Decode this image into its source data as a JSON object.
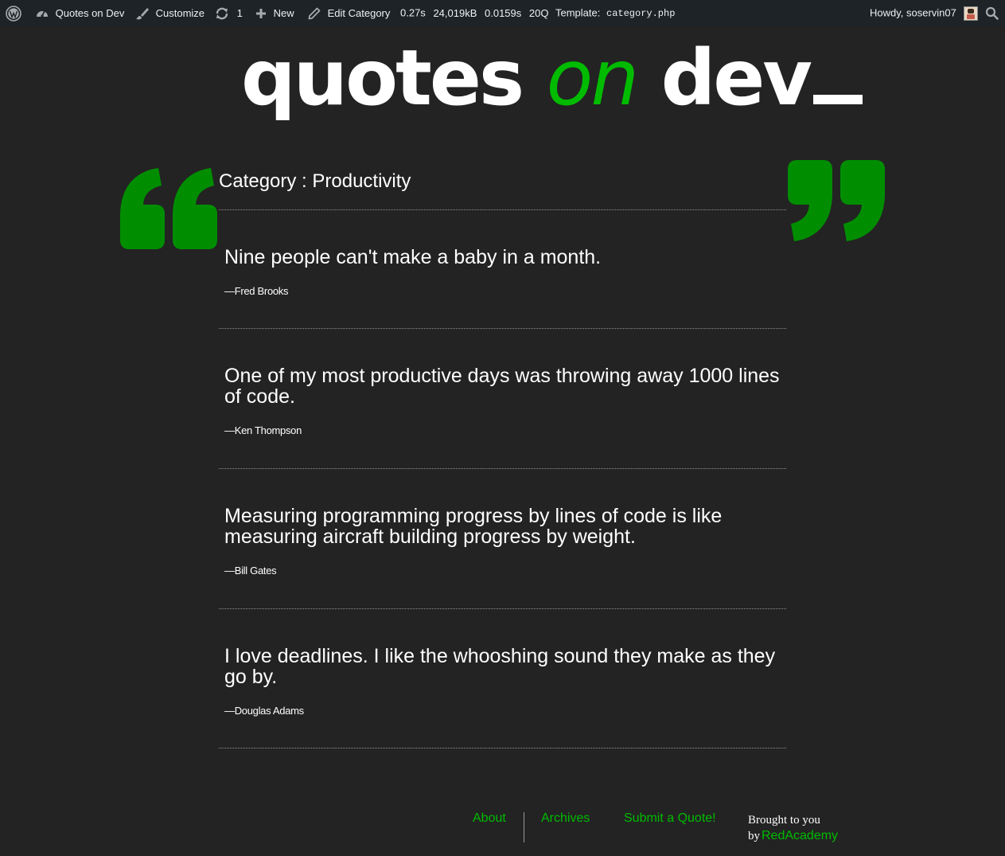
{
  "adminbar": {
    "site_name": "Quotes on Dev",
    "customize": "Customize",
    "updates_count": "1",
    "new": "New",
    "edit": "Edit Category",
    "stats": {
      "time": "0.27s",
      "memory": "24,019kB",
      "query_time": "0.0159s",
      "queries": "20Q"
    },
    "template_label": "Template:",
    "template_file": "category.php",
    "howdy": "Howdy, soservin07",
    "icons": [
      "wordpress-icon",
      "dashboard-icon",
      "brush-icon",
      "refresh-icon",
      "plus-icon",
      "pencil-icon",
      "avatar",
      "search-icon"
    ]
  },
  "logo": {
    "part1": "quotes",
    "part2": "on",
    "part3": "dev",
    "accent_color": "#00bb00"
  },
  "category": {
    "title": "Category : Productivity"
  },
  "quotes": [
    {
      "text": "Nine people can't make a baby in a month.",
      "author": "—Fred Brooks"
    },
    {
      "text": "One of my most productive days was throwing away 1000 lines of code.",
      "author": "—Ken Thompson"
    },
    {
      "text": "Measuring programming progress by lines of code is like measuring aircraft building progress by weight.",
      "author": "—Bill Gates"
    },
    {
      "text": "I love deadlines. I like the whooshing sound they make as they go by.",
      "author": "—Douglas Adams"
    }
  ],
  "footer": {
    "links": [
      "About",
      "Archives",
      "Submit a Quote!"
    ],
    "brought_line1": "Brought to you",
    "brought_by": "by",
    "brand": "RedAcademy"
  },
  "colors": {
    "background": "#232323",
    "adminbar": "#1d2327",
    "accent": "#00bb00",
    "quote_mark": "#008e00"
  }
}
